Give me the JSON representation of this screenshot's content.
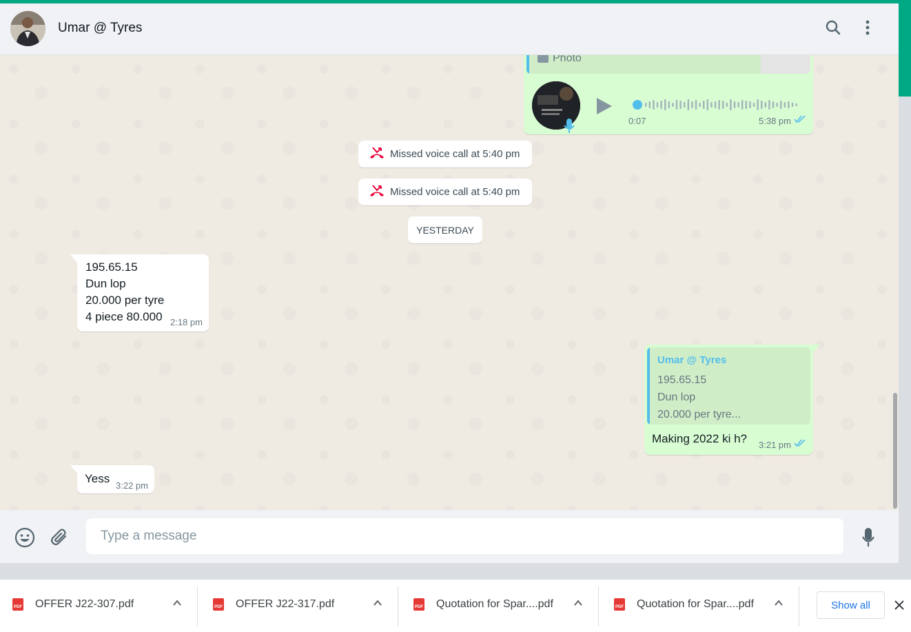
{
  "header": {
    "contact_name": "Umar @ Tyres"
  },
  "messages": {
    "photo_caption": "Photo",
    "voice": {
      "duration": "0:07",
      "time": "5:38 pm"
    },
    "missed_call_1": "Missed voice call at 5:40 pm",
    "missed_call_2": "Missed voice call at 5:40 pm",
    "date_separator": "YESTERDAY",
    "incoming_1": {
      "lines": [
        "195.65.15",
        "Dun lop",
        "20.000 per tyre",
        "4 piece 80.000"
      ],
      "time": "2:18 pm"
    },
    "outgoing_reply": {
      "quote_author": "Umar @ Tyres",
      "quote_lines": [
        "195.65.15",
        "Dun lop",
        "20.000 per tyre..."
      ],
      "text": "Making 2022 ki h?",
      "time": "3:21 pm"
    },
    "incoming_2": {
      "text": "Yess",
      "time": "3:22 pm"
    }
  },
  "composer": {
    "placeholder": "Type a message"
  },
  "downloads": {
    "items": [
      "OFFER J22-307.pdf",
      "OFFER J22-317.pdf",
      "Quotation for Spar....pdf",
      "Quotation for Spar....pdf"
    ],
    "show_all": "Show all"
  },
  "colors": {
    "accent": "#00a884",
    "outgoing_bubble": "#d9fdd3",
    "incoming_bubble": "#ffffff",
    "read_ticks": "#53bdeb",
    "missed_call": "#ea0038",
    "quote_author": "#53bdeb",
    "link_blue": "#1a73e8"
  },
  "icons": [
    "search-icon",
    "menu-icon",
    "play-icon",
    "mic-icon",
    "missed-call-icon",
    "emoji-icon",
    "attach-icon",
    "pdf-icon",
    "chevron-up-icon",
    "close-icon",
    "double-check-icon"
  ]
}
